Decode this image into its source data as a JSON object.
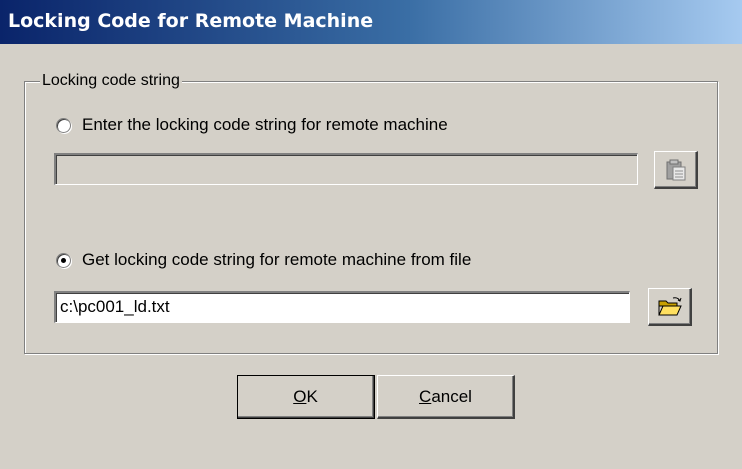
{
  "window": {
    "title": "Locking Code for Remote Machine"
  },
  "group": {
    "label": "Locking code string",
    "option_manual": {
      "label": "Enter the locking code string for remote machine",
      "selected": false,
      "value": ""
    },
    "option_file": {
      "label": "Get locking code string for remote machine from file",
      "selected": true,
      "value": "c:\\pc001_ld.txt"
    }
  },
  "buttons": {
    "ok": {
      "accel": "O",
      "rest": "K"
    },
    "cancel": {
      "accel": "C",
      "rest": "ancel"
    }
  },
  "icons": {
    "paste": "clipboard-paste-icon",
    "browse": "open-folder-icon"
  }
}
